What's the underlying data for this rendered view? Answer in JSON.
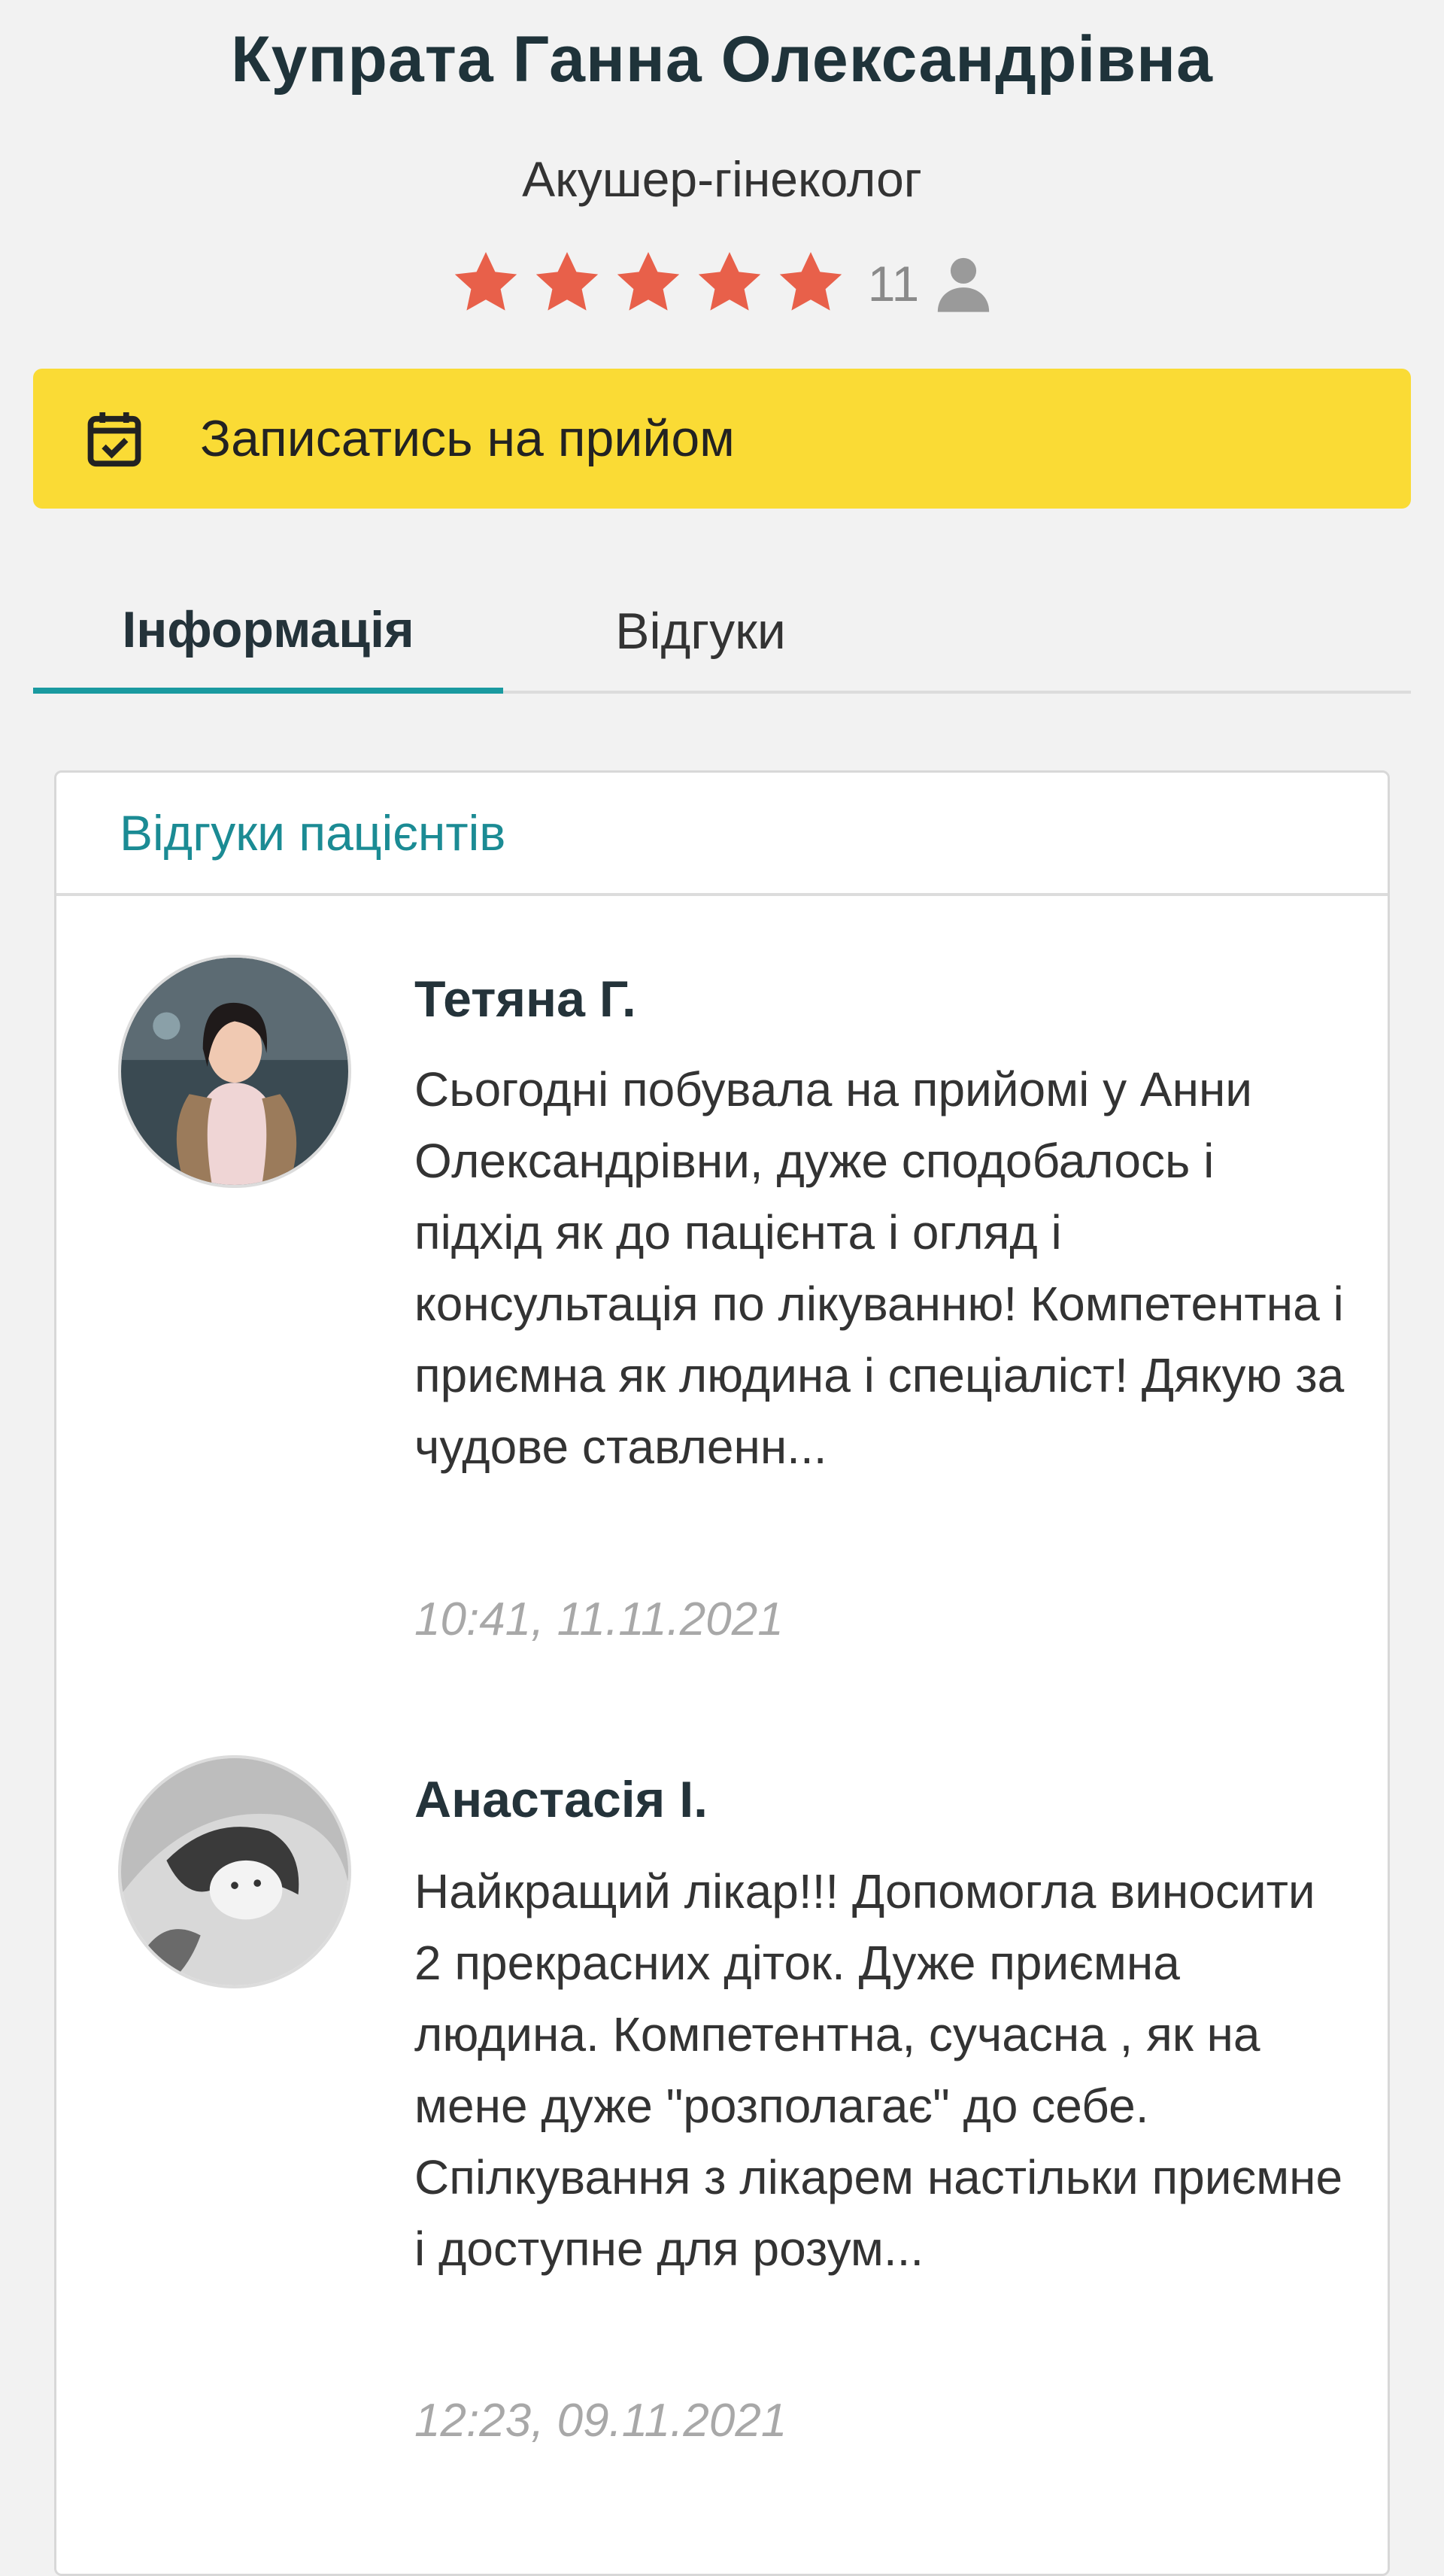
{
  "doctor": {
    "name": "Купрата Ганна Олександрівна",
    "specialty": "Акушер-гінеколог",
    "rating": 5,
    "rating_max": 5,
    "reviews_count": "11",
    "star_color": "#e8604a"
  },
  "booking": {
    "label": "Записатись на прийом",
    "icon": "calendar-check-icon",
    "color": "#fadb35"
  },
  "tabs": [
    {
      "label": "Інформація",
      "active": true
    },
    {
      "label": "Відгуки",
      "active": false
    }
  ],
  "reviews_section": {
    "title": "Відгуки пацієнтів",
    "items": [
      {
        "author": "Тетяна Г.",
        "text": "Сьогодні побувала на прийомі у Анни Олександрівни, дуже сподобалось і підхід як до пацієнта і огляд і консультація по лікуванню! Компетентна і приємна як людина і спеціаліст! Дякую за чудове ставленн...",
        "date": "10:41, 11.11.2021"
      },
      {
        "author": "Анастасія І.",
        "text": "Найкращий лікар!!! Допомогла виносити 2 прекрасних діток. Дуже приємна людина. Компетентна, сучасна , як на мене дуже \"розполагає\" до себе. Спілкування з лікарем настільки приємне і доступне для розум...",
        "date": "12:23, 09.11.2021"
      }
    ]
  }
}
